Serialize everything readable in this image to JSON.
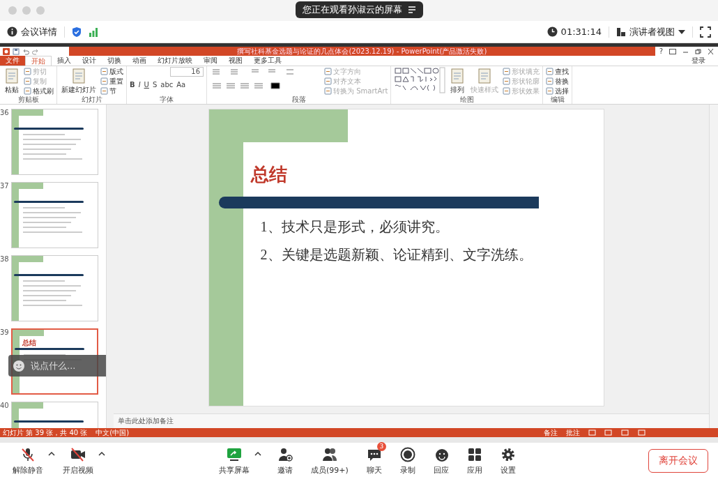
{
  "top_bar": {
    "banner": "您正在观看孙淑云的屏幕",
    "meeting_info": "会议详情",
    "timer": "01:31:14",
    "view_mode": "演讲者视图"
  },
  "ppt": {
    "title": "撰写社科基金选题与论证的几点体会(2023.12.19)  -  PowerPoint(产品激活失败)",
    "help": "?",
    "login": "登录",
    "tabs": [
      {
        "label": "文件",
        "kind": "file",
        "selected": false
      },
      {
        "label": "开始",
        "kind": "tab",
        "selected": true
      },
      {
        "label": "插入",
        "kind": "tab",
        "selected": false
      },
      {
        "label": "设计",
        "kind": "tab",
        "selected": false
      },
      {
        "label": "切换",
        "kind": "tab",
        "selected": false
      },
      {
        "label": "动画",
        "kind": "tab",
        "selected": false
      },
      {
        "label": "幻灯片放映",
        "kind": "tab",
        "selected": false
      },
      {
        "label": "审阅",
        "kind": "tab",
        "selected": false
      },
      {
        "label": "视图",
        "kind": "tab",
        "selected": false
      },
      {
        "label": "更多工具",
        "kind": "tab",
        "selected": false
      }
    ],
    "ribbon": [
      {
        "label": "剪贴板",
        "kind": "plain",
        "columns": [
          [
            {
              "kind": "large",
              "label": "粘贴",
              "disabled": false
            }
          ],
          [
            {
              "kind": "small",
              "label": "剪切",
              "disabled": true
            },
            {
              "kind": "small",
              "label": "复制",
              "disabled": true
            },
            {
              "kind": "small",
              "label": "格式刷",
              "disabled": false
            }
          ]
        ]
      },
      {
        "label": "幻灯片",
        "kind": "plain",
        "columns": [
          [
            {
              "kind": "large",
              "label": "新建幻灯片",
              "disabled": false
            }
          ],
          [
            {
              "kind": "small",
              "label": "版式",
              "disabled": false
            },
            {
              "kind": "small",
              "label": "重置",
              "disabled": false
            },
            {
              "kind": "small",
              "label": "节",
              "disabled": false
            }
          ]
        ]
      },
      {
        "label": "字体",
        "kind": "font",
        "columns": [
          [
            {
              "kind": "field",
              "value": "16"
            },
            {
              "kind": "glyphs",
              "glyphs": [
                "B",
                "I",
                "U",
                "S",
                "abc",
                "Aa"
              ]
            }
          ]
        ]
      },
      {
        "label": "段落",
        "kind": "paragraph",
        "columns": [
          [
            {
              "kind": "small",
              "label": "文字方向",
              "disabled": true
            },
            {
              "kind": "small",
              "label": "对齐文本",
              "disabled": true
            },
            {
              "kind": "small",
              "label": "转换为 SmartArt",
              "disabled": true
            }
          ]
        ]
      },
      {
        "label": "绘图",
        "kind": "shapes",
        "columns": [
          [
            {
              "kind": "large",
              "label": "排列",
              "disabled": false
            }
          ],
          [
            {
              "kind": "large",
              "label": "快速样式",
              "disabled": true
            }
          ],
          [
            {
              "kind": "small",
              "label": "形状填充",
              "disabled": true
            },
            {
              "kind": "small",
              "label": "形状轮廓",
              "disabled": true
            },
            {
              "kind": "small",
              "label": "形状效果",
              "disabled": true
            }
          ]
        ]
      },
      {
        "label": "编辑",
        "kind": "plain",
        "columns": [
          [
            {
              "kind": "small",
              "label": "查找",
              "disabled": false
            },
            {
              "kind": "small",
              "label": "替换",
              "disabled": false
            },
            {
              "kind": "small",
              "label": "选择",
              "disabled": false
            }
          ]
        ]
      }
    ],
    "thumbnails": [
      {
        "number": "36",
        "selected": false
      },
      {
        "number": "37",
        "selected": false
      },
      {
        "number": "38",
        "selected": false
      },
      {
        "number": "39",
        "selected": true,
        "heading": "总结"
      },
      {
        "number": "40",
        "selected": false
      }
    ],
    "slide": {
      "title": "总结",
      "items": [
        "1、技术只是形式，必须讲究。",
        "2、关键是选题新颖、论证精到、文字洗练。"
      ]
    },
    "notes": {
      "placeholder": "单击此处添加备注"
    },
    "chat_input": {
      "placeholder": "说点什么..."
    },
    "status_bar": {
      "slide_info": "幻灯片 第 39 张，共 40 张",
      "language": "中文(中国)",
      "notes": "备注",
      "comments": "批注"
    }
  },
  "toolbar": [
    {
      "label": "解除静音",
      "menu": true
    },
    {
      "label": "开启视频",
      "menu": true
    },
    {
      "label": "共享屏幕",
      "menu": true
    },
    {
      "label": "邀请",
      "menu": false
    },
    {
      "label": "成员(99+)",
      "menu": false
    },
    {
      "label": "聊天",
      "menu": false,
      "badge": "3"
    },
    {
      "label": "录制",
      "menu": false
    },
    {
      "label": "回应",
      "menu": false
    },
    {
      "label": "应用",
      "menu": false
    },
    {
      "label": "设置",
      "menu": false
    }
  ],
  "leave_button": "离开会议"
}
